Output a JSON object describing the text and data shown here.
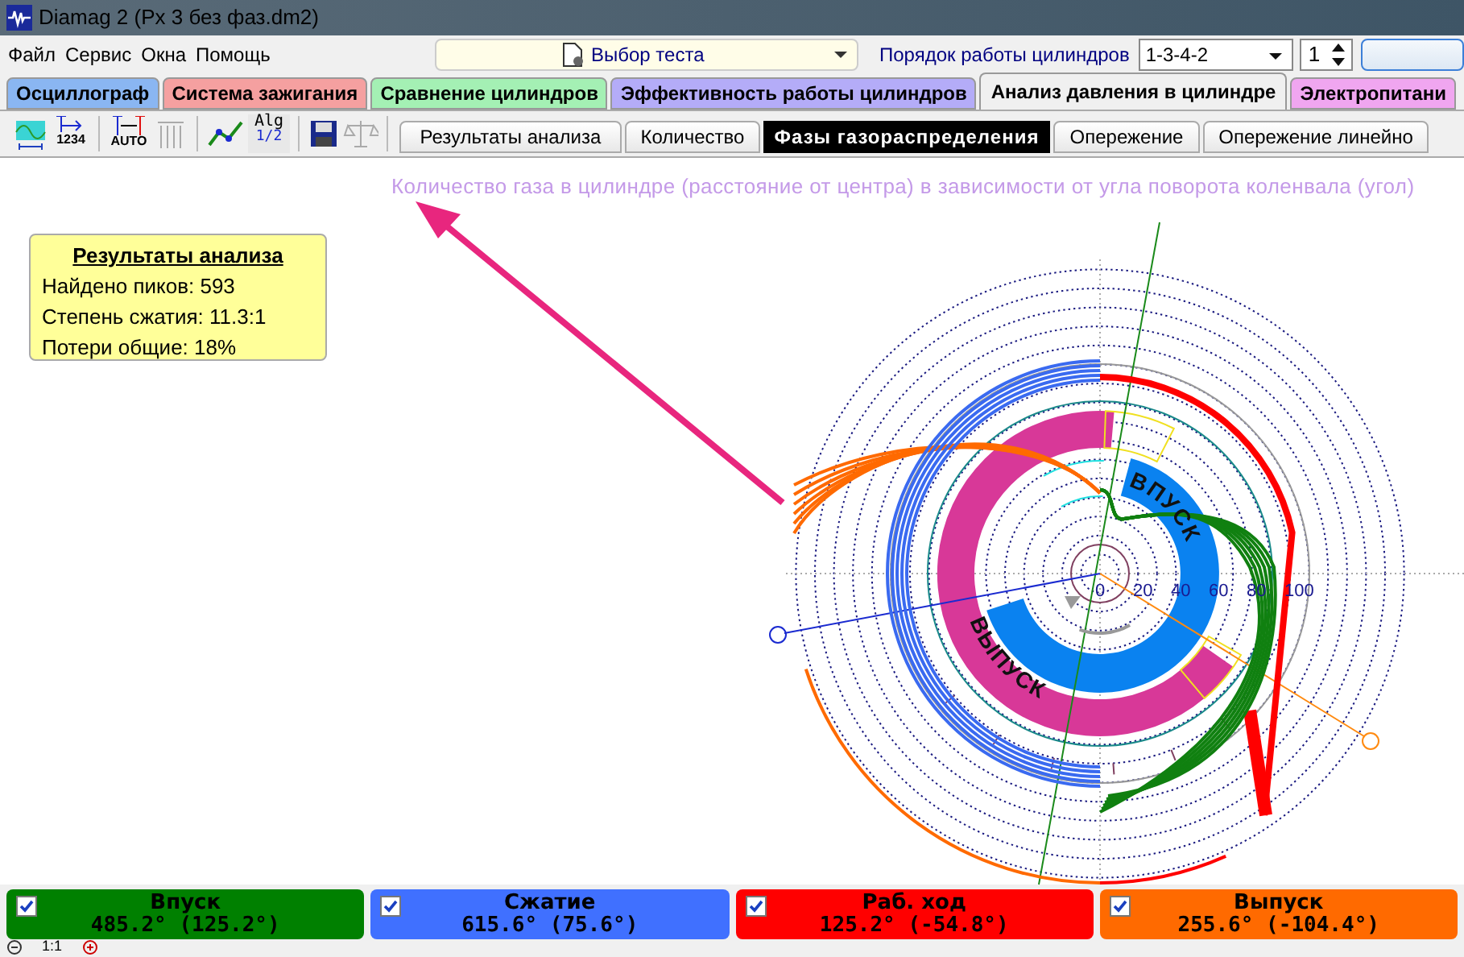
{
  "window": {
    "title": "Diamag 2 (Px 3 без фаз.dm2)"
  },
  "menu": [
    "Файл",
    "Сервис",
    "Окна",
    "Помощь"
  ],
  "test_select": {
    "value": "Выбор теста"
  },
  "cylinder_order": {
    "label": "Порядок работы цилиндров",
    "value": "1-3-4-2"
  },
  "cylinder_spinner": {
    "value": "1"
  },
  "tabs": [
    {
      "label": "Осциллограф",
      "color": "#8ab6f2",
      "selected": false
    },
    {
      "label": "Система зажигания",
      "color": "#f5a0a0",
      "selected": false
    },
    {
      "label": "Сравнение цилиндров",
      "color": "#a4f0b4",
      "selected": false
    },
    {
      "label": "Эффективность работы цилиндров",
      "color": "#b4acf8",
      "selected": false
    },
    {
      "label": "Анализ давления в цилиндре",
      "color": "#f0f0f0",
      "selected": true
    },
    {
      "label": "Электропитани",
      "color": "#f0a6f0",
      "selected": false
    }
  ],
  "toolbar_texts": {
    "counter": "1234",
    "auto": "AUTO",
    "alg": "Alg",
    "alg_fraction": "1/2"
  },
  "subtabs": [
    {
      "label": "Результаты анализа",
      "selected": false
    },
    {
      "label": "Количество",
      "selected": false
    },
    {
      "label": "Фазы газораспределения",
      "selected": true
    },
    {
      "label": "Опережение",
      "selected": false
    },
    {
      "label": "Опережение линейно",
      "selected": false
    }
  ],
  "chart": {
    "title": "Количество газа в цилиндре (расстояние от центра) в зависимости от угла поворота коленвала (угол)",
    "radial_labels": [
      "0",
      "20",
      "40",
      "60",
      "80",
      "100"
    ],
    "arc_labels": [
      "ВПУСК",
      "ВЫПУСК"
    ]
  },
  "results": {
    "title": "Результаты анализа",
    "lines": [
      "Найдено пиков: 593",
      "Степень сжатия: 11.3:1",
      "Потери общие: 18%"
    ]
  },
  "phases": [
    {
      "name": "Впуск",
      "value": "485.2° (125.2°)",
      "color": "#008000",
      "checked": true
    },
    {
      "name": "Сжатие",
      "value": "615.6° (75.6°)",
      "color": "#4070ff",
      "checked": true
    },
    {
      "name": "Раб. ход",
      "value": "125.2° (-54.8°)",
      "color": "#ff0000",
      "checked": true
    },
    {
      "name": "Выпуск",
      "value": "255.6° (-104.4°)",
      "color": "#ff6a00",
      "checked": true
    }
  ],
  "zoom_label": "1:1"
}
